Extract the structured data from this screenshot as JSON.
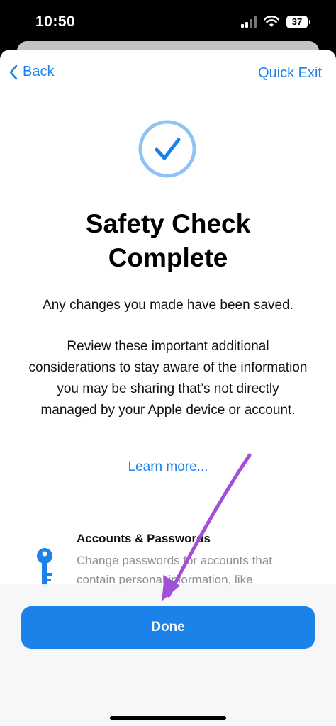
{
  "status": {
    "time": "10:50",
    "battery": "37",
    "icons": [
      "signal-icon",
      "wifi-icon",
      "battery-icon"
    ]
  },
  "nav": {
    "back_label": "Back",
    "quick_exit_label": "Quick Exit"
  },
  "content": {
    "title_line1": "Safety Check",
    "title_line2": "Complete",
    "saved_text": "Any changes you made have been saved.",
    "review_text": "Review these important additional considerations to stay aware of the information you may be sharing that’s not directly managed by your Apple device or account.",
    "learn_more": "Learn more..."
  },
  "accounts": {
    "title": "Accounts & Passwords",
    "description": "Change passwords for accounts that contain personal information, like"
  },
  "footer": {
    "done_label": "Done"
  },
  "colors": {
    "accent": "#1a82e8",
    "check_ring": "#8fc3f5",
    "annotation_arrow": "#a350d9"
  }
}
